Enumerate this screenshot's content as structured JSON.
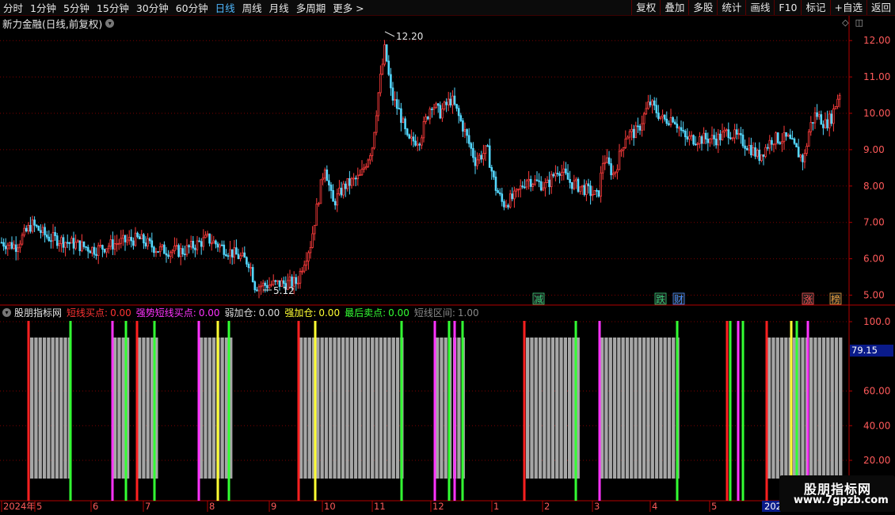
{
  "toolbar": {
    "periods": [
      "分时",
      "1分钟",
      "5分钟",
      "15分钟",
      "30分钟",
      "60分钟",
      "日线",
      "周线",
      "月线",
      "多周期",
      "更多 >"
    ],
    "active_period": "日线",
    "buttons": [
      "复权",
      "叠加",
      "多股",
      "统计",
      "画线",
      "F10",
      "标记",
      "+自选",
      "返回"
    ]
  },
  "chart": {
    "title": "新力金融(日线,前复权)",
    "y_axis": [
      "12.00",
      "11.00",
      "10.00",
      "9.00",
      "8.00",
      "7.00",
      "6.00",
      "5.00"
    ],
    "high_label": "12.20",
    "low_label": "5.12",
    "events": [
      {
        "label": "减",
        "color": "#3ad07a"
      },
      {
        "label": "跌",
        "color": "#3ad07a"
      },
      {
        "label": "财",
        "color": "#4a90ff"
      },
      {
        "label": "涨",
        "color": "#ff5555"
      },
      {
        "label": "榜",
        "color": "#e6a040"
      }
    ]
  },
  "indicator": {
    "name": "股朋指标网",
    "legend": [
      {
        "label": "短线买点:",
        "value": "0.00",
        "color": "#ff3333"
      },
      {
        "label": "强势短线买点:",
        "value": "0.00",
        "color": "#ff33ff"
      },
      {
        "label": "弱加仓:",
        "value": "0.00",
        "color": "#dddddd"
      },
      {
        "label": "强加仓:",
        "value": "0.00",
        "color": "#ffff33"
      },
      {
        "label": "最后卖点:",
        "value": "0.00",
        "color": "#33ff33"
      },
      {
        "label": "短线区间:",
        "value": "1.00",
        "color": "#888888"
      }
    ],
    "y_axis": [
      "100.0",
      "60.00",
      "40.00",
      "20.00"
    ],
    "current_value": "79.15"
  },
  "x_axis": [
    "2024年",
    "5",
    "6",
    "7",
    "8",
    "9",
    "10",
    "11",
    "12",
    "1",
    "2",
    "3",
    "4",
    "5",
    "202"
  ],
  "watermark": {
    "line1": "股朋指标网",
    "line2": "www.7gpzb.com"
  },
  "colors": {
    "up": "#ff3c3c",
    "down": "#54d8ff",
    "axis": "#b40000",
    "grid": "#7a0000"
  }
}
